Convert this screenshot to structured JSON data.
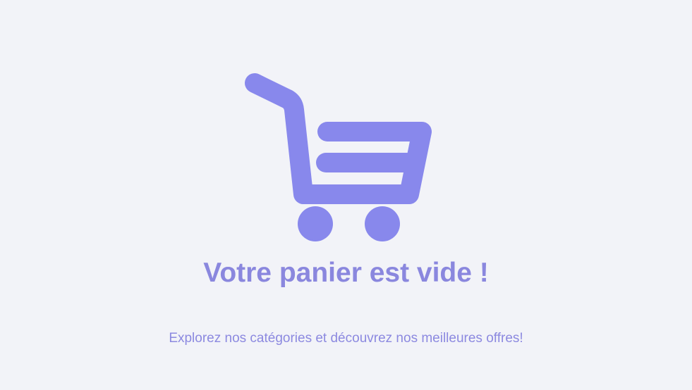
{
  "empty_cart": {
    "icon": "shopping-cart-icon",
    "accent_color": "#8888ec",
    "title": "Votre panier est vide !",
    "subtitle": "Explorez nos catégories et découvrez nos meilleures offres!"
  }
}
